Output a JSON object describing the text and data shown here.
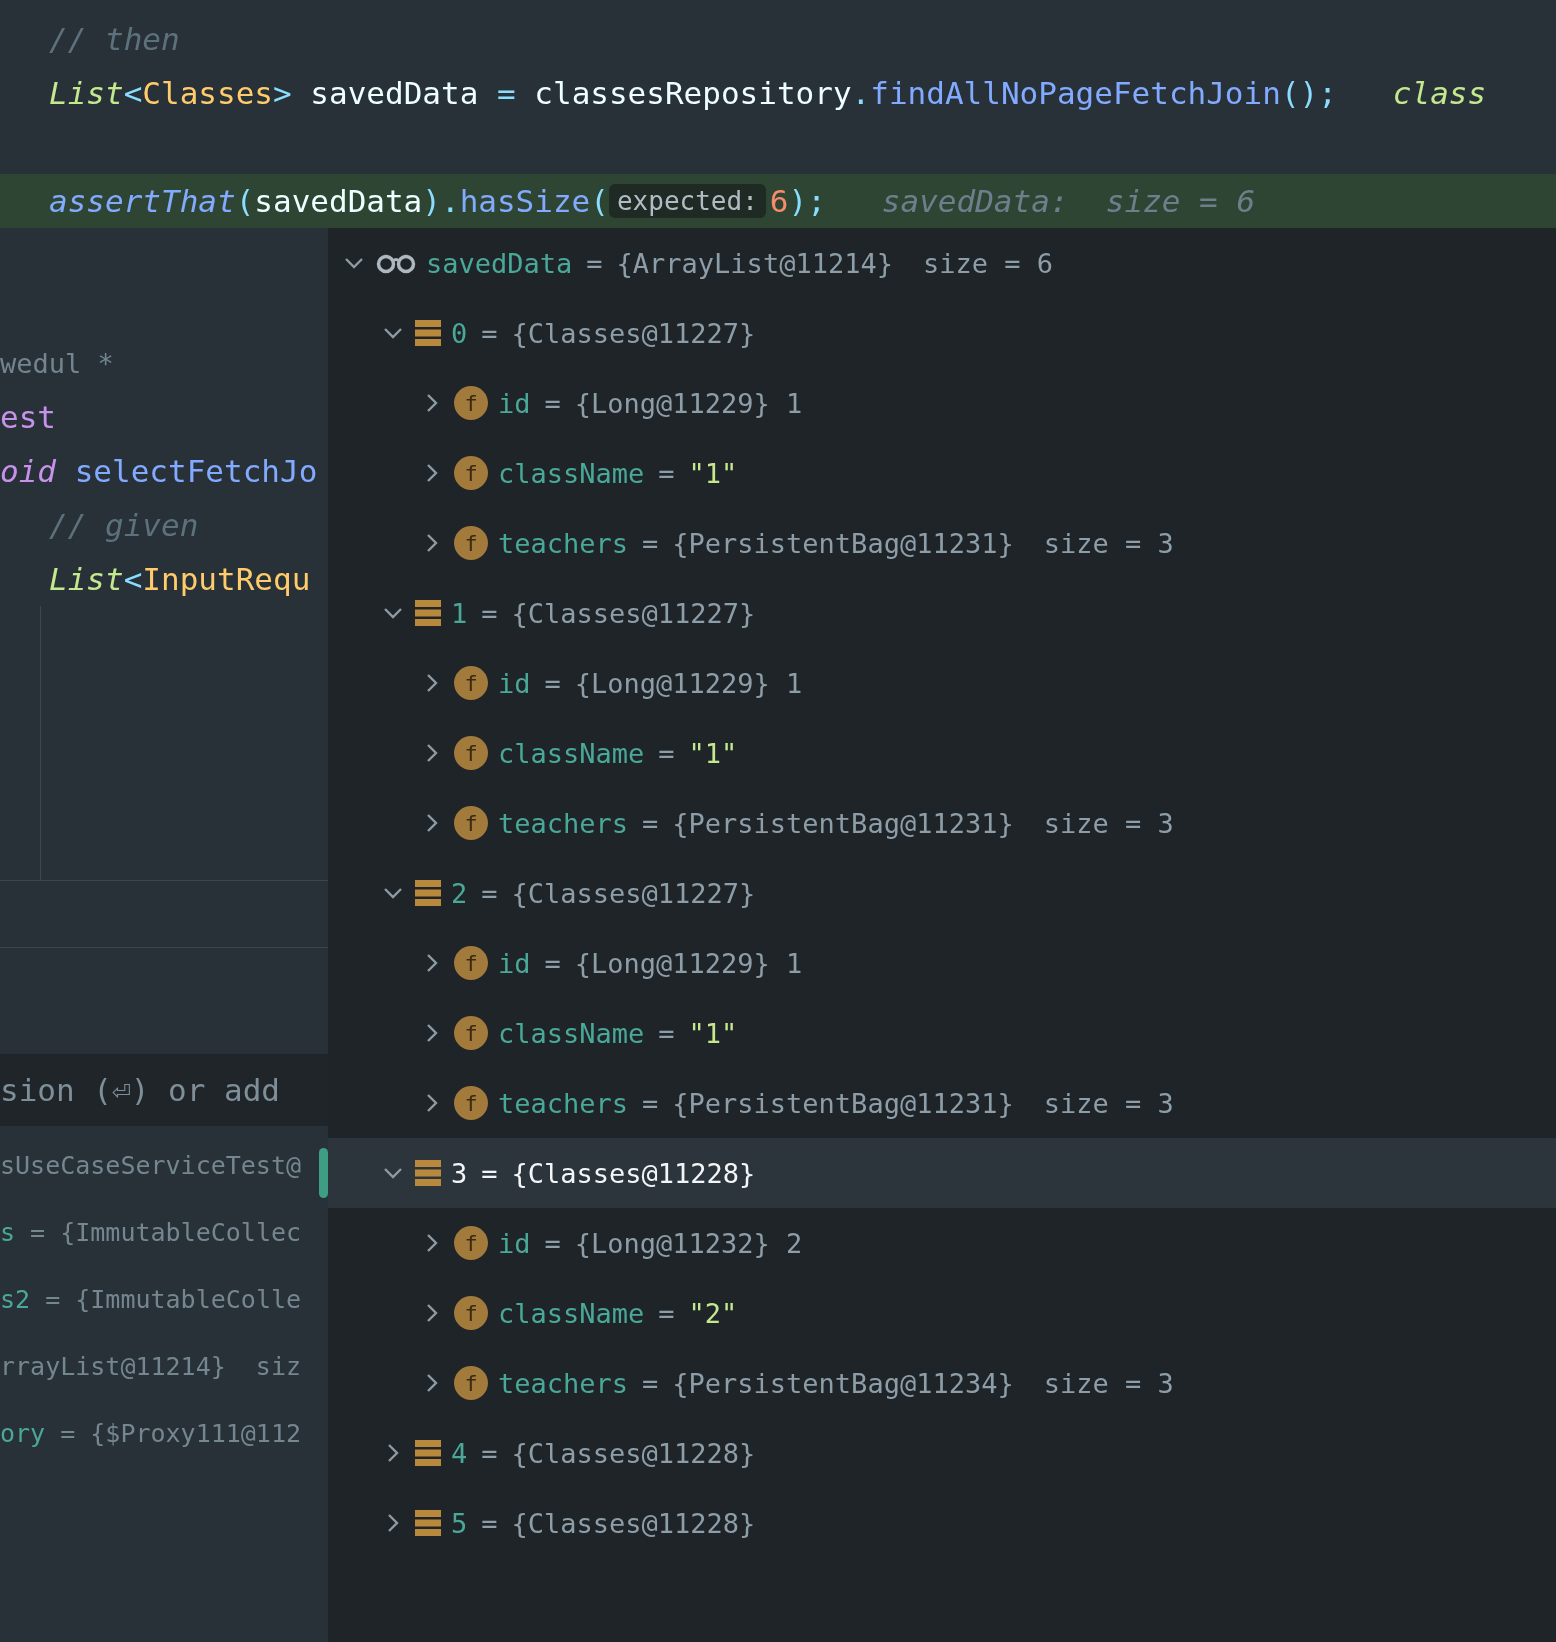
{
  "editor": {
    "lines": [
      {
        "highlighted": false,
        "tokens": [
          {
            "text": "// then",
            "kind": "comment"
          }
        ]
      },
      {
        "highlighted": false,
        "tokens": [
          {
            "text": "List",
            "kind": "type"
          },
          {
            "text": "<",
            "kind": "punct"
          },
          {
            "text": "Classes",
            "kind": "class"
          },
          {
            "text": ">",
            "kind": "punct"
          },
          {
            "text": " savedData ",
            "kind": "plain"
          },
          {
            "text": "=",
            "kind": "punct"
          },
          {
            "text": " classesRepository",
            "kind": "plain"
          },
          {
            "text": ".",
            "kind": "punct"
          },
          {
            "text": "findAllNoPageFetchJoin",
            "kind": "method"
          },
          {
            "text": "();",
            "kind": "punct"
          },
          {
            "text": "   class",
            "kind": "hint_value"
          }
        ]
      },
      {
        "highlighted": false
      },
      {
        "highlighted": true,
        "tokens": [
          {
            "text": "assertThat",
            "kind": "static"
          },
          {
            "text": "(",
            "kind": "punct"
          },
          {
            "text": "savedData",
            "kind": "plain"
          },
          {
            "text": ").",
            "kind": "punct"
          },
          {
            "text": "hasSize",
            "kind": "method"
          },
          {
            "text": "(",
            "kind": "punct"
          },
          {
            "text": "expected:",
            "kind": "inlay"
          },
          {
            "text": "6",
            "kind": "number"
          },
          {
            "text": ");",
            "kind": "punct"
          },
          {
            "text": "   savedData:  size = 6",
            "kind": "hint"
          }
        ]
      }
    ]
  },
  "editor_fragment": {
    "lines": [
      {
        "indented": false,
        "tokens": [
          {
            "text": "wedul *",
            "kind": "doc"
          }
        ]
      },
      {
        "indented": false,
        "tokens": [
          {
            "text": "est",
            "kind": "annotation"
          }
        ]
      },
      {
        "indented": false,
        "tokens": [
          {
            "text": "oid",
            "kind": "keyword"
          },
          {
            "text": " selectFetchJo",
            "kind": "method"
          }
        ]
      },
      {
        "indented": true,
        "tokens": [
          {
            "text": "// given",
            "kind": "comment"
          }
        ]
      },
      {
        "indented": true,
        "tokens": [
          {
            "text": "List",
            "kind": "type"
          },
          {
            "text": "<",
            "kind": "punct"
          },
          {
            "text": "InputRequ",
            "kind": "class"
          }
        ]
      }
    ]
  },
  "evaluate_field": {
    "placeholder": "sion (⏎) or add"
  },
  "variables": [
    {
      "value": "sUseCaseServiceTest@"
    },
    {
      "name": "s",
      "value": " = {ImmutableCollec"
    },
    {
      "name": "s2",
      "value": " = {ImmutableColle"
    },
    {
      "value": "rrayList@11214}  siz"
    },
    {
      "name": "ory",
      "value": " = {$Proxy111@112"
    }
  ],
  "popup": {
    "root": {
      "kind": "watch",
      "name": "savedData",
      "sep": "=",
      "value": "{ArrayList@11214}",
      "extra": "size = 6",
      "expanded": true,
      "selected": false,
      "children": [
        {
          "kind": "element",
          "name": "0",
          "sep": "=",
          "value": "{Classes@11227}",
          "expanded": true,
          "selected": false,
          "children": [
            {
              "kind": "field",
              "badge": "f",
              "name": "id",
              "sep": "=",
              "value": "{Long@11229} 1",
              "quoted": false,
              "expanded": false,
              "selected": false
            },
            {
              "kind": "field",
              "badge": "f",
              "name": "className",
              "sep": "=",
              "value": "\"1\"",
              "quoted": true,
              "expanded": false,
              "selected": false
            },
            {
              "kind": "field",
              "badge": "f",
              "name": "teachers",
              "sep": "=",
              "value": "{PersistentBag@11231}",
              "extra": "size = 3",
              "quoted": false,
              "expanded": false,
              "selected": false
            }
          ]
        },
        {
          "kind": "element",
          "name": "1",
          "sep": "=",
          "value": "{Classes@11227}",
          "expanded": true,
          "selected": false,
          "children": [
            {
              "kind": "field",
              "badge": "f",
              "name": "id",
              "sep": "=",
              "value": "{Long@11229} 1",
              "quoted": false,
              "expanded": false,
              "selected": false
            },
            {
              "kind": "field",
              "badge": "f",
              "name": "className",
              "sep": "=",
              "value": "\"1\"",
              "quoted": true,
              "expanded": false,
              "selected": false
            },
            {
              "kind": "field",
              "badge": "f",
              "name": "teachers",
              "sep": "=",
              "value": "{PersistentBag@11231}",
              "extra": "size = 3",
              "quoted": false,
              "expanded": false,
              "selected": false
            }
          ]
        },
        {
          "kind": "element",
          "name": "2",
          "sep": "=",
          "value": "{Classes@11227}",
          "expanded": true,
          "selected": false,
          "children": [
            {
              "kind": "field",
              "badge": "f",
              "name": "id",
              "sep": "=",
              "value": "{Long@11229} 1",
              "quoted": false,
              "expanded": false,
              "selected": false
            },
            {
              "kind": "field",
              "badge": "f",
              "name": "className",
              "sep": "=",
              "value": "\"1\"",
              "quoted": true,
              "expanded": false,
              "selected": false
            },
            {
              "kind": "field",
              "badge": "f",
              "name": "teachers",
              "sep": "=",
              "value": "{PersistentBag@11231}",
              "extra": "size = 3",
              "quoted": false,
              "expanded": false,
              "selected": false
            }
          ]
        },
        {
          "kind": "element",
          "name": "3",
          "sep": "=",
          "value": "{Classes@11228}",
          "expanded": true,
          "selected": true,
          "children": [
            {
              "kind": "field",
              "badge": "f",
              "name": "id",
              "sep": "=",
              "value": "{Long@11232} 2",
              "quoted": false,
              "expanded": false,
              "selected": false
            },
            {
              "kind": "field",
              "badge": "f",
              "name": "className",
              "sep": "=",
              "value": "\"2\"",
              "quoted": true,
              "expanded": false,
              "selected": false
            },
            {
              "kind": "field",
              "badge": "f",
              "name": "teachers",
              "sep": "=",
              "value": "{PersistentBag@11234}",
              "extra": "size = 3",
              "quoted": false,
              "expanded": false,
              "selected": false
            }
          ]
        },
        {
          "kind": "element",
          "name": "4",
          "sep": "=",
          "value": "{Classes@11228}",
          "expanded": false,
          "selected": false
        },
        {
          "kind": "element",
          "name": "5",
          "sep": "=",
          "value": "{Classes@11228}",
          "expanded": false,
          "selected": false
        }
      ]
    }
  }
}
